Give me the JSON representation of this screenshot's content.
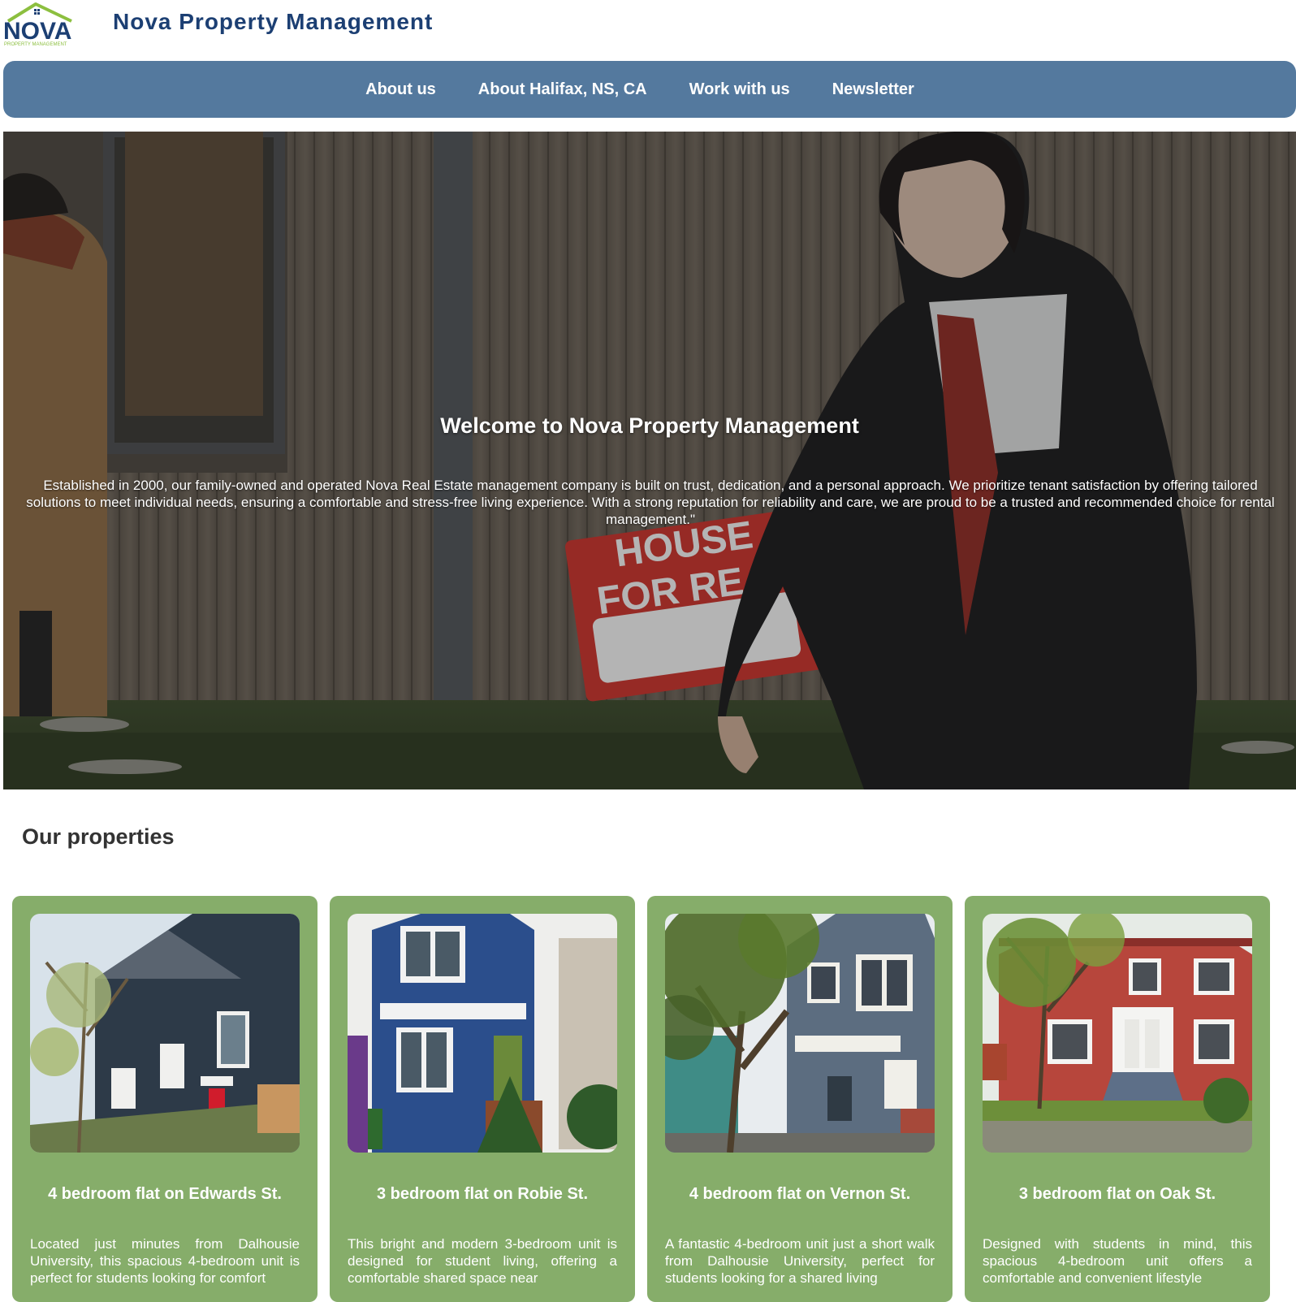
{
  "header": {
    "logo_text": "NOVA",
    "logo_subtext": "PROPERTY MANAGEMENT",
    "site_title": "Nova Property Management"
  },
  "nav": {
    "items": [
      {
        "label": "About us"
      },
      {
        "label": "About Halifax, NS, CA"
      },
      {
        "label": "Work with us"
      },
      {
        "label": "Newsletter"
      }
    ]
  },
  "hero": {
    "title": "Welcome to Nova Property Management",
    "text": "Established in 2000, our family-owned and operated Nova Real Estate management company is built on trust, dedication, and a personal approach. We prioritize tenant satisfaction by offering tailored solutions to meet individual needs, ensuring a comfortable and stress-free living experience. With a strong reputation for reliability and care, we are proud to be a trusted and recommended choice for rental management.\"",
    "sign_text_1": "HOUSE",
    "sign_text_2": "FOR RE"
  },
  "properties": {
    "section_title": "Our properties",
    "cards": [
      {
        "title": "4 bedroom flat on Edwards St.",
        "description": "Located just minutes from Dalhousie University, this spacious 4-bedroom unit is perfect for students looking for comfort"
      },
      {
        "title": "3 bedroom flat on Robie St.",
        "description": "This bright and modern 3-bedroom unit is designed for student living, offering a comfortable shared space near"
      },
      {
        "title": "4 bedroom flat on Vernon St.",
        "description": "A fantastic 4-bedroom unit just a short walk from Dalhousie University, perfect for students looking for a shared living"
      },
      {
        "title": "3 bedroom flat on Oak St.",
        "description": "Designed with students in mind, this spacious 4-bedroom unit offers a comfortable and convenient lifestyle"
      }
    ]
  },
  "colors": {
    "brand_navy": "#1c3f73",
    "nav_blue": "#54799e",
    "card_green": "#86ad6a",
    "logo_green": "#8cbf3f"
  }
}
